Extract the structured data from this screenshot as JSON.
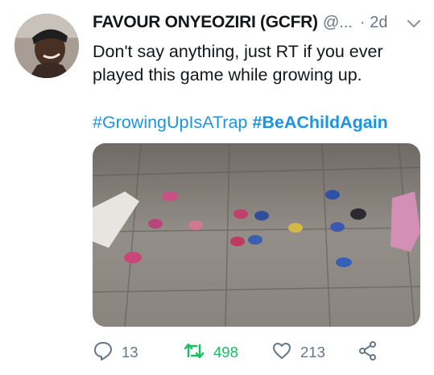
{
  "tweet": {
    "author_name": "FAVOUR ONYEOZIRI (GCFR)",
    "handle": "@...",
    "time": "· 2d",
    "text": "Don't say anything, just RT if you ever played this game while growing up.",
    "hashtags": [
      "#GrowingUpIsATrap",
      "#BeAChildAgain"
    ]
  },
  "actions": {
    "reply_count": "13",
    "retweet_count": "498",
    "like_count": "213"
  },
  "colors": {
    "link": "#1b95e0",
    "retweet_active": "#17bf63",
    "secondary_text": "#657786"
  },
  "icons": [
    "chevron-down-icon",
    "reply-icon",
    "retweet-icon",
    "like-icon",
    "share-icon"
  ]
}
